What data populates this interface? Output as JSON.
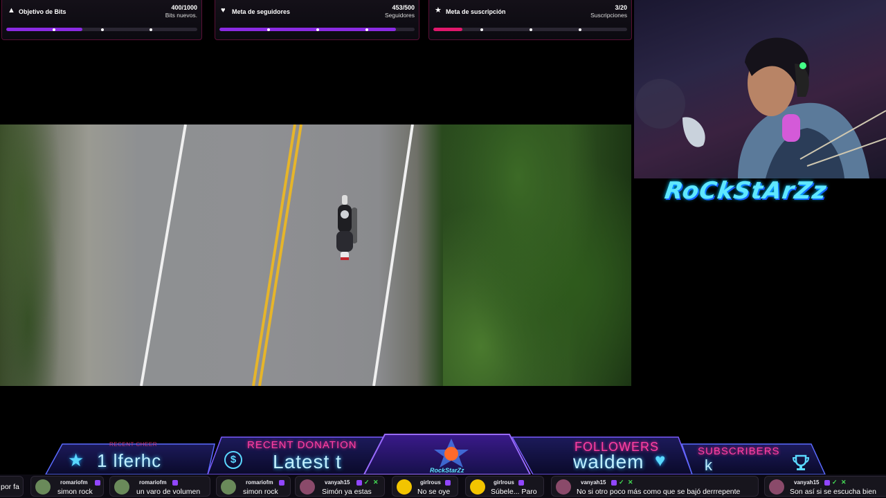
{
  "goals": [
    {
      "title": "Objetivo de Bits",
      "count": "400/1000",
      "unit": "Bits nuevos.",
      "icon": "bits-icon",
      "progress": 0.4,
      "fill_color": "#8a2be2"
    },
    {
      "title": "Meta de seguidores",
      "count": "453/500",
      "unit": "Seguidores",
      "icon": "heart-icon",
      "progress": 0.906,
      "fill_color": "#8a2be2"
    },
    {
      "title": "Meta de suscripción",
      "count": "3/20",
      "unit": "Suscripciones",
      "icon": "star-icon",
      "progress": 0.15,
      "fill_color": "#e0186c"
    }
  ],
  "brand": {
    "text": "RoCkStArZz"
  },
  "bottom_bar": {
    "recent_cheer_label": "RECENT CHEER",
    "recent_cheer_value": "1 lferhc",
    "recent_donation_label": "RECENT DONATION",
    "recent_donation_value": "Latest t",
    "logo_text": "RockStarZz",
    "followers_label": "FOLLOWERS",
    "followers_value": "waldem",
    "subscribers_label": "SUBSCRIBERS",
    "subscribers_value": "k"
  },
  "chat": [
    {
      "user": "",
      "message": "por fa",
      "avatar_color": "#444"
    },
    {
      "user": "romariofm",
      "message": "simon rock",
      "avatar_color": "#6a8a5a"
    },
    {
      "user": "romariofm",
      "message": "un varo de volumen",
      "avatar_color": "#6a8a5a"
    },
    {
      "user": "romariofm",
      "message": "simon rock",
      "avatar_color": "#6a8a5a"
    },
    {
      "user": "vanyah15",
      "message": "Simón ya estas",
      "avatar_color": "#8a4a6a"
    },
    {
      "user": "girlrous",
      "message": "No se oye",
      "avatar_color": "#f2c400"
    },
    {
      "user": "girlrous",
      "message": "Súbele... Paro",
      "avatar_color": "#f2c400"
    },
    {
      "user": "vanyah15",
      "message": "No si otro poco más como que se bajó derrrepente",
      "avatar_color": "#8a4a6a"
    },
    {
      "user": "vanyah15",
      "message": "Son así si se escucha bien",
      "avatar_color": "#8a4a6a"
    }
  ]
}
